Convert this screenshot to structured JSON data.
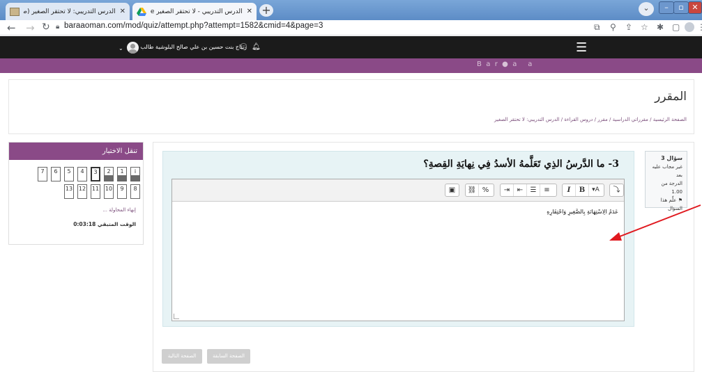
{
  "browser": {
    "tabs": [
      {
        "title": "الدرس التدريبي: لا تحتقر الصغير (صفحة 4"
      },
      {
        "title": "الدرس التدريبي - لا تحتقر الصغير Drive"
      }
    ],
    "url": "baraaoman.com/mod/quiz/attempt.php?attempt=1582&cmid=4&page=3"
  },
  "sitenav": {
    "username": "ريتاج بنت حسين بن علي صالح البلوشية طالب",
    "brand": "B  a  r  ●  a     a"
  },
  "header": {
    "title": "المقرر",
    "breadcrumb": [
      "الصفحة الرئيسية",
      "مقرراتي الدراسية",
      "مقرر",
      "دروس القراءة",
      "الدرس التدريبي: لا تحتقر الصغير"
    ]
  },
  "quiz_nav": {
    "heading": "تنقل الاختبار",
    "row1": [
      "i",
      "1",
      "2",
      "3",
      "4",
      "5",
      "6",
      "7"
    ],
    "row2": [
      "8",
      "9",
      "10",
      "11",
      "12",
      "13"
    ],
    "finish_link": "إنهاء المحاولة ...",
    "time_label": "الوقت المتبقي 0:03:18"
  },
  "question_info": {
    "number": "سؤال 3",
    "status": "غير مجاب عليه بعد",
    "mark": "الدرجة من 1.00",
    "flag": "علِّم هذا السؤال"
  },
  "question": {
    "text": "3- ما الدَّرسُ الذِي تَعَلَّمهُ الأسدُ فِي نِهايَةِ القِصةِ؟",
    "answer": "عَدَمُ الِاسْتِهَانَةِ بِالصَّغِيرِ وَاحْتِقَارِهِ"
  },
  "buttons": {
    "previous": "الصفحة السابقة",
    "next": "الصفحة التالية"
  },
  "colors": {
    "brand_purple": "#8a4a87",
    "nav_dark": "#1b1b1b",
    "question_bg": "#e7f3f5",
    "arrow": "#e0191f"
  }
}
